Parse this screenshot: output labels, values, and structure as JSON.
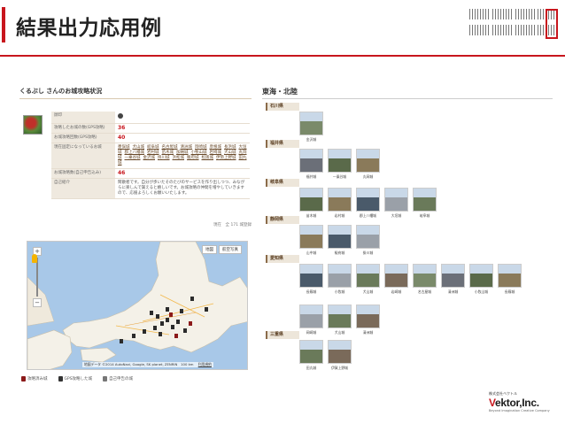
{
  "slide": {
    "title": "結果出力応用例"
  },
  "profile": {
    "heading": "くるぶし さんのお城攻略状況",
    "rows": [
      {
        "label": "顔印",
        "value": ""
      },
      {
        "label": "攻略したお城の数(GPS攻略)",
        "value": "36"
      },
      {
        "label": "お城攻略回数(GPS攻略)",
        "value": "40"
      },
      {
        "label": "現在固定になっているお城",
        "value": ""
      },
      {
        "label": "お城攻略数(自己申告込み)",
        "value": "46"
      },
      {
        "label": "自己紹介",
        "value": "閑散者です。自分が歩いたそのたびのサービスを作り出しつつ、みながらに楽しんで貰えると嬉しいです。お城攻略の仲間を増やしていきますので、応援よろしくお願いいたします。"
      }
    ],
    "castle_links": [
      "墨俣城",
      "犬山城",
      "岐阜城",
      "名古屋城",
      "清洲城",
      "岡崎城",
      "彦根城",
      "長浜城",
      "大垣城",
      "郡上八幡城",
      "岩村城",
      "苗木城",
      "加納城",
      "小牧山城",
      "岩崎城",
      "犬山城",
      "丸岡城",
      "一乗谷城",
      "金沢城",
      "掛川城",
      "浜松城",
      "駿府城",
      "松阪城",
      "伊勢上野城",
      "田丸城"
    ],
    "footer": "現在　全 171 城登録"
  },
  "map": {
    "btn_map": "地図",
    "btn_sat": "航空写真",
    "zoom_in": "+",
    "zoom_out": "−",
    "credit": "地図データ ©2014 AutoNavi, Google, SK planet, ZENRIN　100 km",
    "terms": "利用規約"
  },
  "legend": [
    {
      "label": "攻略済み城",
      "color": "#8b1a1a"
    },
    {
      "label": "GPS攻略した城",
      "color": "#333333"
    },
    {
      "label": "自己申告の城",
      "color": "#777777"
    }
  ],
  "region": {
    "title": "東海・北陸",
    "prefs": [
      {
        "name": "石川県",
        "castles": [
          "金沢城"
        ]
      },
      {
        "name": "福井県",
        "castles": [
          "福井城",
          "一乗谷城",
          "丸岡城"
        ]
      },
      {
        "name": "岐阜県",
        "castles": [
          "苗木城",
          "岩村城",
          "郡上八幡城",
          "大垣城",
          "岐阜城"
        ]
      },
      {
        "name": "静岡県",
        "castles": [
          "山中城",
          "駿府城",
          "掛川城"
        ]
      },
      {
        "name": "愛知県",
        "castles": [
          "長篠城",
          "小牧城",
          "犬山城",
          "岩崎城",
          "名古屋城",
          "清洲城",
          "小牧山城",
          "長篠城"
        ]
      },
      {
        "name": "",
        "castles": [
          "岡崎城",
          "犬山城",
          "清洲城"
        ]
      },
      {
        "name": "三重県",
        "castles": [
          "田丸城",
          "伊賀上野城"
        ]
      }
    ]
  },
  "logo": {
    "company_small": "株式会社ベクトル",
    "company_big_v": "V",
    "company_big_rest": "ektor,Inc.",
    "tagline": "Beyond Imagination Creative Company"
  },
  "colors": {
    "accent": "#c8161d",
    "pref_label_bg": "#ede6da"
  }
}
